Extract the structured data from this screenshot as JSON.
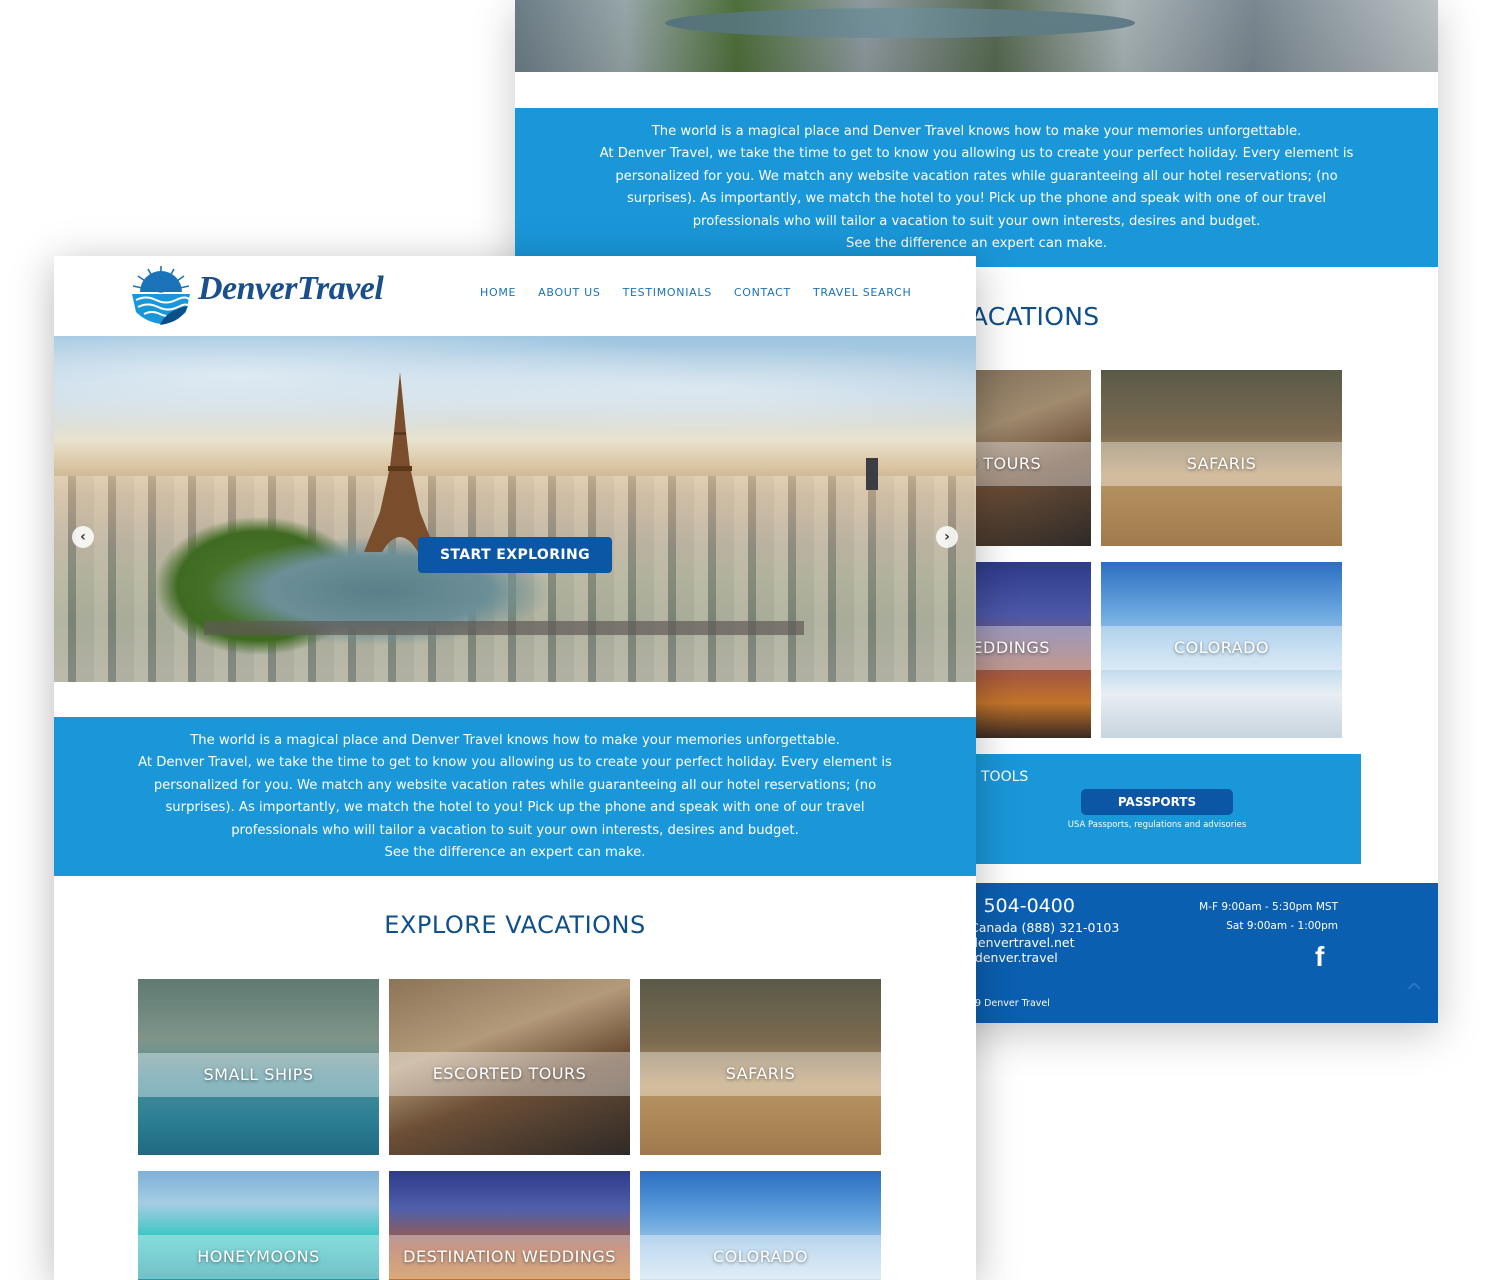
{
  "back_view": {
    "intro": {
      "line1": "The world is a magical place and Denver Travel knows how to make your memories unforgettable.",
      "line2": "At Denver Travel, we take the time to get to know you allowing us to create your perfect holiday. Every element is personalized for you. We match any website vacation rates while guaranteeing all our hotel reservations; (no surprises). As importantly, we match the hotel to you! Pick up the phone and speak with one of our travel professionals who will tailor a vacation to suit your own interests, desires and budget.",
      "line3": "See the difference an expert can make."
    },
    "explore_title": "VACATIONS",
    "tiles": [
      {
        "label": "D TOURS"
      },
      {
        "label": "SAFARIS"
      },
      {
        "label": "WEDDINGS"
      },
      {
        "label": "COLORADO"
      }
    ],
    "tools": {
      "label": "TOOLS",
      "passports_button": "PASSPORTS",
      "passports_sub": "USA Passports, regulations and advisories"
    },
    "footer": {
      "phone": ") 504-0400",
      "canada": "Canada (888) 321-0103",
      "email": "denvertravel.net",
      "web": "tdenver.travel",
      "copyright": "9 Denver Travel",
      "hours_weekday": "M-F 9:00am - 5:30pm MST",
      "hours_saturday": "Sat 9:00am - 1:00pm",
      "facebook_glyph": "f",
      "top_glyph": "^"
    }
  },
  "front_view": {
    "brand": {
      "word1": "Denver",
      "word2": "Travel"
    },
    "nav": [
      "HOME",
      "ABOUT US",
      "TESTIMONIALS",
      "CONTACT",
      "TRAVEL SEARCH"
    ],
    "hero": {
      "cta_label": "START EXPLORING",
      "prev_glyph": "‹",
      "next_glyph": "›"
    },
    "intro": {
      "line1": "The world is a magical place and Denver Travel knows how to make your memories unforgettable.",
      "line2": "At Denver Travel, we take the time to get to know you allowing us to create your perfect holiday. Every element is personalized for you. We match any website vacation rates while guaranteeing all our hotel reservations; (no surprises). As importantly, we match the hotel to you! Pick up the phone and speak with one of our travel professionals who will tailor a vacation to suit your own interests, desires and budget.",
      "line3": "See the difference an expert can make."
    },
    "explore_title": "EXPLORE VACATIONS",
    "tiles": [
      {
        "label": "SMALL SHIPS"
      },
      {
        "label": "ESCORTED TOURS"
      },
      {
        "label": "SAFARIS"
      },
      {
        "label": "HONEYMOONS"
      },
      {
        "label": "DESTINATION WEDDINGS"
      },
      {
        "label": "COLORADO"
      }
    ]
  },
  "colors": {
    "brand_blue": "#1a97d9",
    "button_blue": "#0b57a6",
    "footer_blue": "#0b5fb0",
    "heading_navy": "#0f4f8a",
    "nav_blue": "#1a73b8"
  }
}
